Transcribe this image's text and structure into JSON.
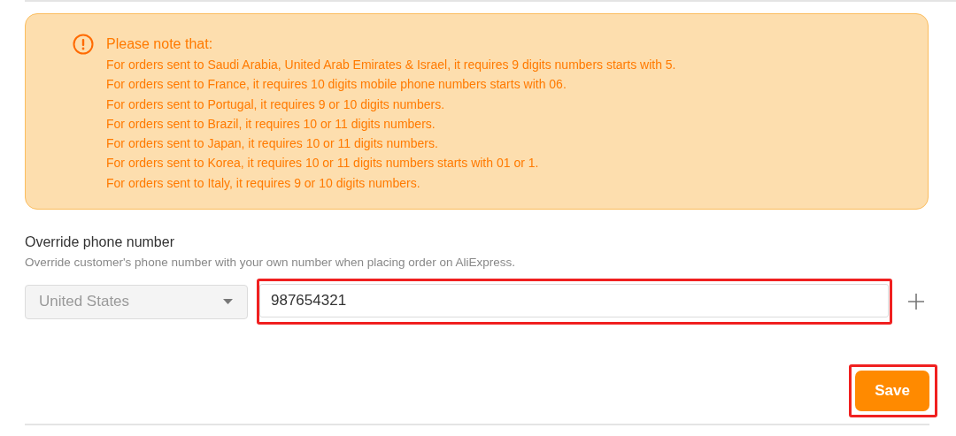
{
  "notice": {
    "title": "Please note that:",
    "lines": [
      "For orders sent to Saudi Arabia, United Arab Emirates & Israel, it requires 9 digits numbers starts with 5.",
      "For orders sent to France, it requires 10 digits mobile phone numbers starts with 06.",
      "For orders sent to Portugal, it requires 9 or 10 digits numbers.",
      "For orders sent to Brazil, it requires 10 or 11 digits numbers.",
      "For orders sent to Japan, it requires 10 or 11 digits numbers.",
      "For orders sent to Korea, it requires 10 or 11 digits numbers starts with 01 or 1.",
      "For orders sent to Italy, it requires 9 or 10 digits numbers."
    ]
  },
  "section": {
    "title": "Override phone number",
    "description": "Override customer's phone number with your own number when placing order on AliExpress."
  },
  "country_select": {
    "value": "United States",
    "disabled": true
  },
  "phone_field": {
    "value": "987654321",
    "highlighted": true
  },
  "save_button": {
    "label": "Save",
    "highlighted": true
  }
}
